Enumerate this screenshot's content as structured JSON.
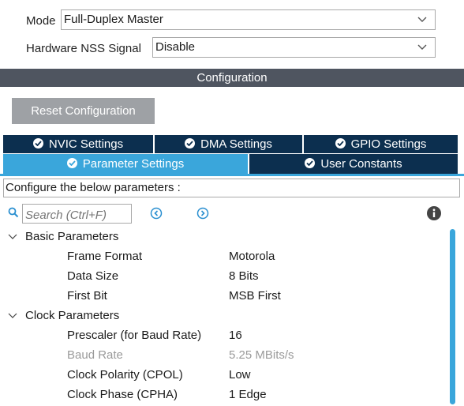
{
  "mode": {
    "label": "Mode",
    "value": "Full-Duplex Master"
  },
  "nss": {
    "label": "Hardware NSS Signal",
    "value": "Disable"
  },
  "configuration": {
    "title": "Configuration",
    "reset_label": "Reset Configuration"
  },
  "tabs": {
    "row1": [
      {
        "label": "NVIC Settings",
        "icon": "check-circle-icon"
      },
      {
        "label": "DMA Settings",
        "icon": "check-circle-icon"
      },
      {
        "label": "GPIO Settings",
        "icon": "check-circle-icon"
      }
    ],
    "row2": [
      {
        "label": "Parameter Settings",
        "icon": "check-circle-icon",
        "active": true
      },
      {
        "label": "User Constants",
        "icon": "check-circle-icon",
        "active": false
      }
    ]
  },
  "description": "Configure the below parameters :",
  "search": {
    "placeholder": "Search (Ctrl+F)"
  },
  "groups": [
    {
      "label": "Basic Parameters",
      "params": [
        {
          "name": "Frame Format",
          "value": "Motorola"
        },
        {
          "name": "Data Size",
          "value": "8 Bits"
        },
        {
          "name": "First Bit",
          "value": "MSB First"
        }
      ]
    },
    {
      "label": "Clock Parameters",
      "params": [
        {
          "name": "Prescaler (for Baud Rate)",
          "value": "16"
        },
        {
          "name": "Baud Rate",
          "value": "5.25 MBits/s",
          "disabled": true
        },
        {
          "name": "Clock Polarity (CPOL)",
          "value": "Low"
        },
        {
          "name": "Clock Phase (CPHA)",
          "value": "1 Edge"
        }
      ]
    }
  ],
  "colors": {
    "header_bar": "#4f5560",
    "tab_dark": "#0c2f4f",
    "tab_active": "#3aa6db",
    "button": "#9ea1a5"
  }
}
